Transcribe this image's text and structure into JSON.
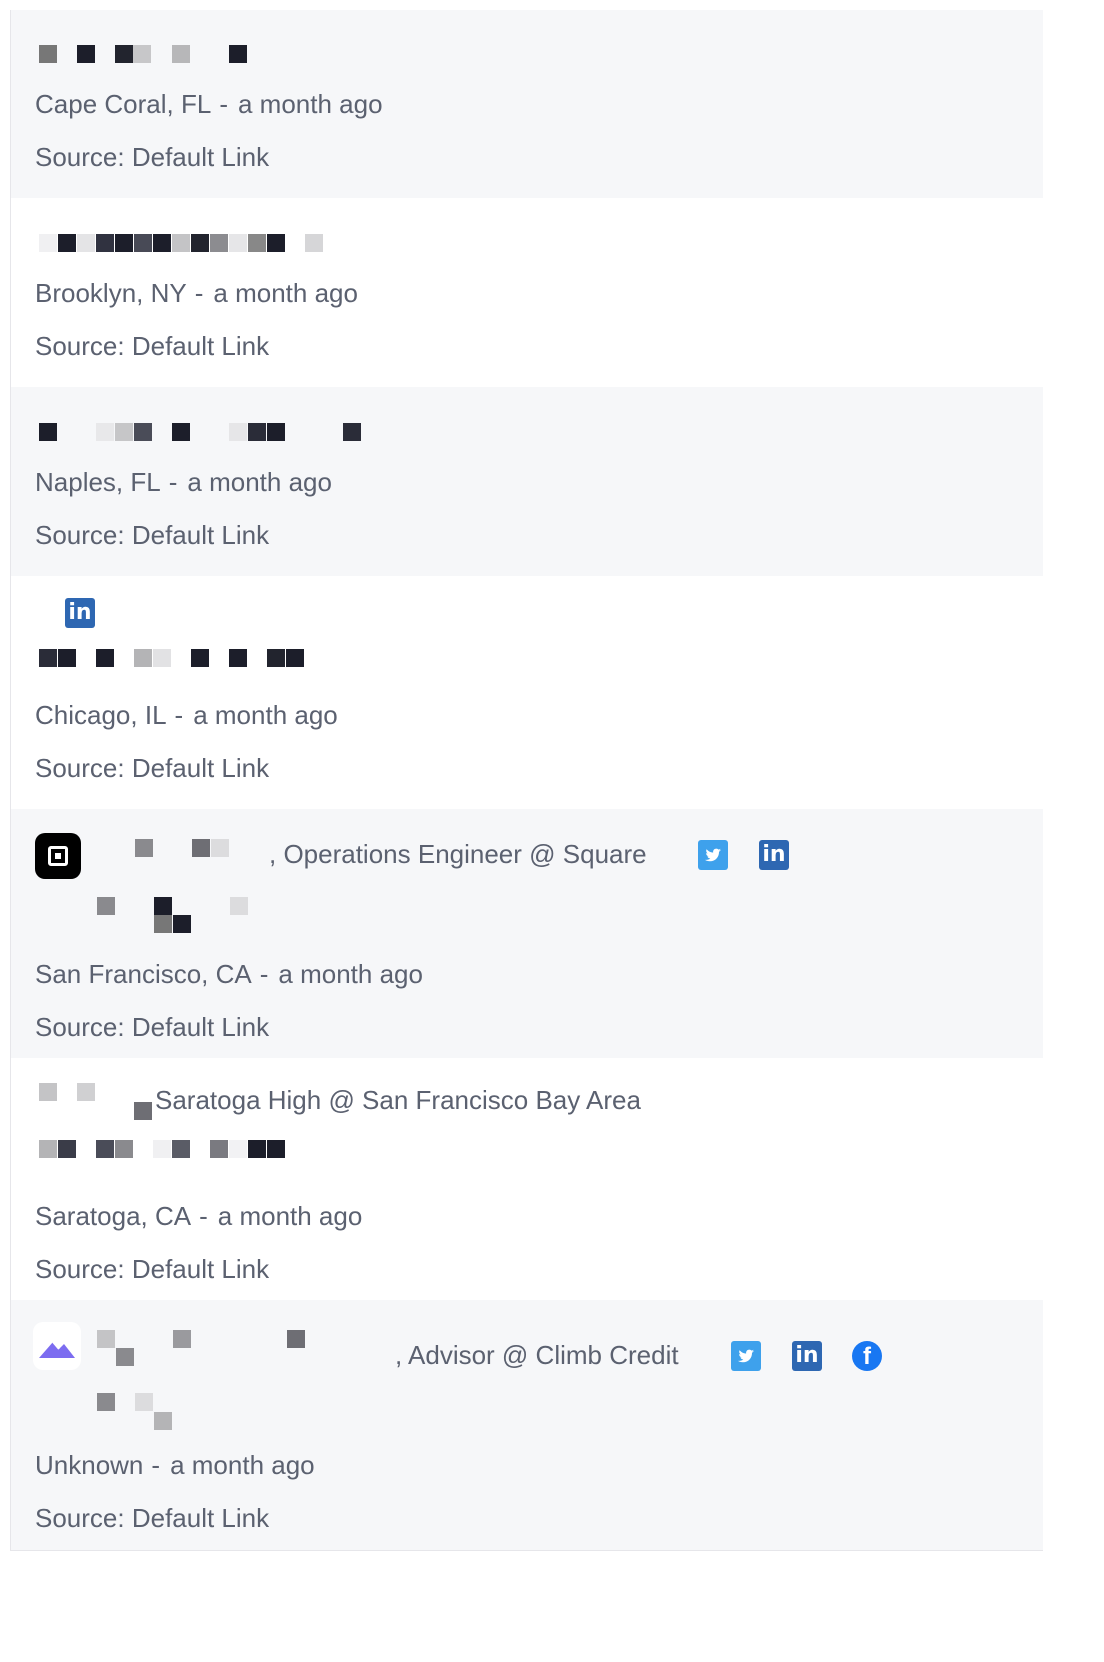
{
  "rows": [
    {
      "location": "Cape Coral, FL",
      "time": "a month ago",
      "source": "Source: Default Link"
    },
    {
      "location": "Brooklyn, NY",
      "time": "a month ago",
      "source": "Source: Default Link"
    },
    {
      "location": "Naples, FL",
      "time": "a month ago",
      "source": "Source: Default Link"
    },
    {
      "location": "Chicago, IL",
      "time": "a month ago",
      "source": "Source: Default Link",
      "social": [
        "linkedin-icon"
      ]
    },
    {
      "location": "San Francisco, CA",
      "time": "a month ago",
      "source": "Source: Default Link",
      "headline": ", Operations Engineer @ Square",
      "company_logo": "square-logo-icon",
      "social": [
        "twitter-icon",
        "linkedin-icon"
      ]
    },
    {
      "location": "Saratoga, CA",
      "time": "a month ago",
      "source": "Source: Default Link",
      "headline": "Saratoga High @ San Francisco Bay Area"
    },
    {
      "location": "Unknown",
      "time": "a month ago",
      "source": "Source: Default Link",
      "headline": ", Advisor @ Climb Credit",
      "company_logo": "climb-credit-logo-icon",
      "social": [
        "twitter-icon",
        "linkedin-icon",
        "facebook-icon"
      ]
    }
  ],
  "separator": "-",
  "linkedin_glyph": "in",
  "facebook_glyph": "f",
  "colors": {
    "row_alt_bg": "#f6f7f9",
    "text": "#5b6170",
    "twitter": "#3ea1ec",
    "linkedin": "#2e67b2",
    "facebook": "#1877f2"
  }
}
